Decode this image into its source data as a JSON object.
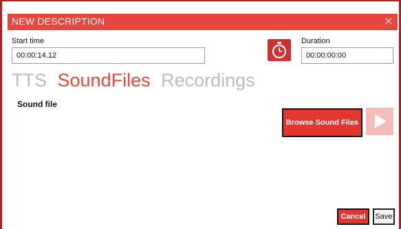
{
  "dialog": {
    "title": "NEW DESCRIPTION",
    "close_glyph": "×",
    "accent_color": "#e8473e"
  },
  "start_time": {
    "label": "Start time",
    "value": "00:00:14.12"
  },
  "timer_button": {
    "icon": "stopwatch-icon"
  },
  "duration": {
    "label": "Duration",
    "value": "00:00:00:00"
  },
  "tabs": [
    {
      "label": "TTS",
      "active": false
    },
    {
      "label": "SoundFiles",
      "active": true
    },
    {
      "label": "Recordings",
      "active": false
    }
  ],
  "sound_file": {
    "label": "Sound file",
    "browse_label": "Browse Sound Files",
    "play_icon": "play-icon"
  },
  "footer": {
    "cancel_label": "Cancel",
    "save_label": "Save"
  }
}
